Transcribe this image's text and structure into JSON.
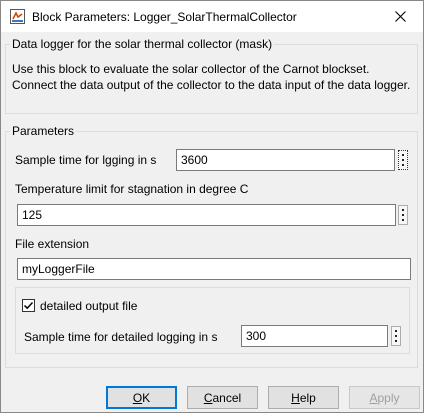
{
  "window": {
    "title": "Block Parameters: Logger_SolarThermalCollector",
    "icon": "simulink-block-icon",
    "close_icon": "close-icon"
  },
  "mask": {
    "group_title": "Data logger for the solar thermal collector (mask)",
    "description": "Use this block to evaluate the solar collector of the Carnot blockset. Connect the data output of the collector to the data input of the data logger."
  },
  "parameters": {
    "group_title": "Parameters",
    "sample_time_label": "Sample time for lgging in s",
    "sample_time_value": "3600",
    "temp_limit_label": "Temperature limit for stagnation in degree C",
    "temp_limit_value": "125",
    "file_ext_label": "File extension",
    "file_ext_value": "myLoggerFile",
    "detailed": {
      "checkbox_label": "detailed output file",
      "checked": true,
      "sample_label": "Sample time for detailed logging in s",
      "sample_value": "300"
    }
  },
  "buttons": {
    "ok": {
      "pre": "",
      "accel": "O",
      "post": "K"
    },
    "cancel": {
      "pre": "",
      "accel": "C",
      "post": "ancel"
    },
    "help": {
      "pre": "",
      "accel": "H",
      "post": "elp"
    },
    "apply": {
      "pre": "",
      "accel": "A",
      "post": "pply"
    }
  }
}
